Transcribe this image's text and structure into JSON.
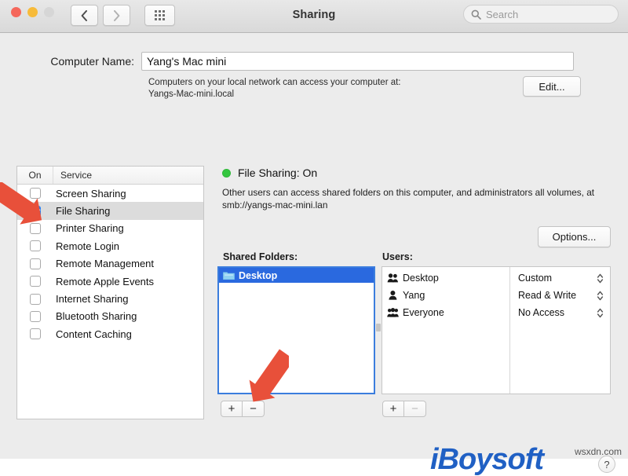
{
  "window": {
    "title": "Sharing",
    "traffic_lights": [
      "close-red",
      "minimize-yellow",
      "zoom-disabled"
    ],
    "nav": {
      "back": "back-chevron",
      "forward": "forward-chevron",
      "grid": "show-all-grid"
    }
  },
  "search": {
    "placeholder": "Search",
    "value": "",
    "icon": "search-icon"
  },
  "computer_name": {
    "label": "Computer Name:",
    "value": "Yang's Mac mini",
    "hint_line_1": "Computers on your local network can access your computer at:",
    "hint_line_2": "Yangs-Mac-mini.local",
    "edit_button": "Edit..."
  },
  "services": {
    "header_on": "On",
    "header_service": "Service",
    "items": [
      {
        "name": "Screen Sharing",
        "checked": false,
        "selected": false
      },
      {
        "name": "File Sharing",
        "checked": true,
        "selected": true
      },
      {
        "name": "Printer Sharing",
        "checked": false,
        "selected": false
      },
      {
        "name": "Remote Login",
        "checked": false,
        "selected": false
      },
      {
        "name": "Remote Management",
        "checked": false,
        "selected": false
      },
      {
        "name": "Remote Apple Events",
        "checked": false,
        "selected": false
      },
      {
        "name": "Internet Sharing",
        "checked": false,
        "selected": false
      },
      {
        "name": "Bluetooth Sharing",
        "checked": false,
        "selected": false
      },
      {
        "name": "Content Caching",
        "checked": false,
        "selected": false
      }
    ]
  },
  "detail": {
    "status_dot_color": "#34c63f",
    "status": "File Sharing: On",
    "description": "Other users can access shared folders on this computer, and administrators all volumes, at smb://yangs-mac-mini.lan",
    "options_button": "Options...",
    "shared_folders_label": "Shared Folders:",
    "users_label": "Users:",
    "shared_folders": [
      {
        "name": "Desktop",
        "selected": true,
        "icon": "folder-icon"
      }
    ],
    "users": [
      {
        "name": "Desktop",
        "icon": "group-icon",
        "permission": "Custom"
      },
      {
        "name": "Yang",
        "icon": "person-icon",
        "permission": "Read & Write"
      },
      {
        "name": "Everyone",
        "icon": "everyone-icon",
        "permission": "No Access"
      }
    ],
    "folder_add": "+",
    "folder_remove": "−",
    "user_add": "+",
    "user_remove": "−"
  },
  "branding": {
    "logo_text": "iBoysoft",
    "logo_color": "#2060c4",
    "help_button": "?",
    "watermark": "wsxdn.com"
  },
  "annotations": {
    "arrow_color": "#e8503a",
    "arrow_1_target": "file-sharing-checkbox",
    "arrow_2_target": "add-shared-folder-button"
  }
}
